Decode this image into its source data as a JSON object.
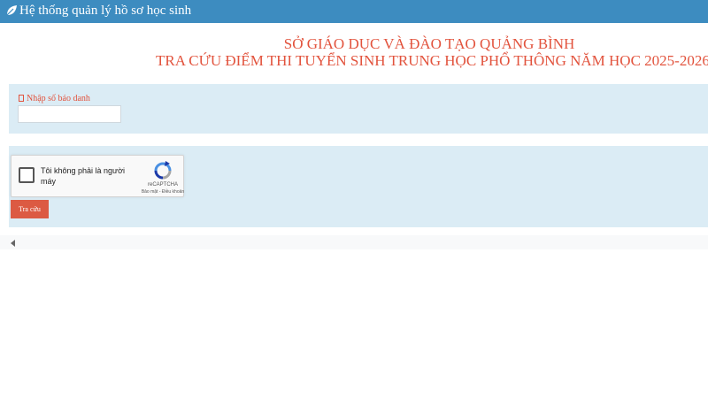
{
  "app": {
    "title": "Hệ thống quản lý hồ sơ học sinh",
    "logo_icon": "leaf-icon"
  },
  "heading": {
    "line1": "SỞ GIÁO DỤC VÀ ĐÀO TẠO QUẢNG BÌNH",
    "line2": "TRA CỨU ĐIỂM THI TUYỂN SINH TRUNG HỌC PHỔ THÔNG NĂM HỌC 2025-2026"
  },
  "form": {
    "sbd_label": "Nhập số báo danh",
    "sbd_value": "",
    "submit_label": "Tra cứu"
  },
  "recaptcha": {
    "checkbox_label": "Tôi không phải là người máy",
    "brand": "reCAPTCHA",
    "links": "Bảo mật - Điều khoản",
    "checked": false
  },
  "colors": {
    "topbar": "#3d8cc0",
    "heading": "#e2533d",
    "panel": "#dbecf5",
    "button": "#dc5a43"
  }
}
